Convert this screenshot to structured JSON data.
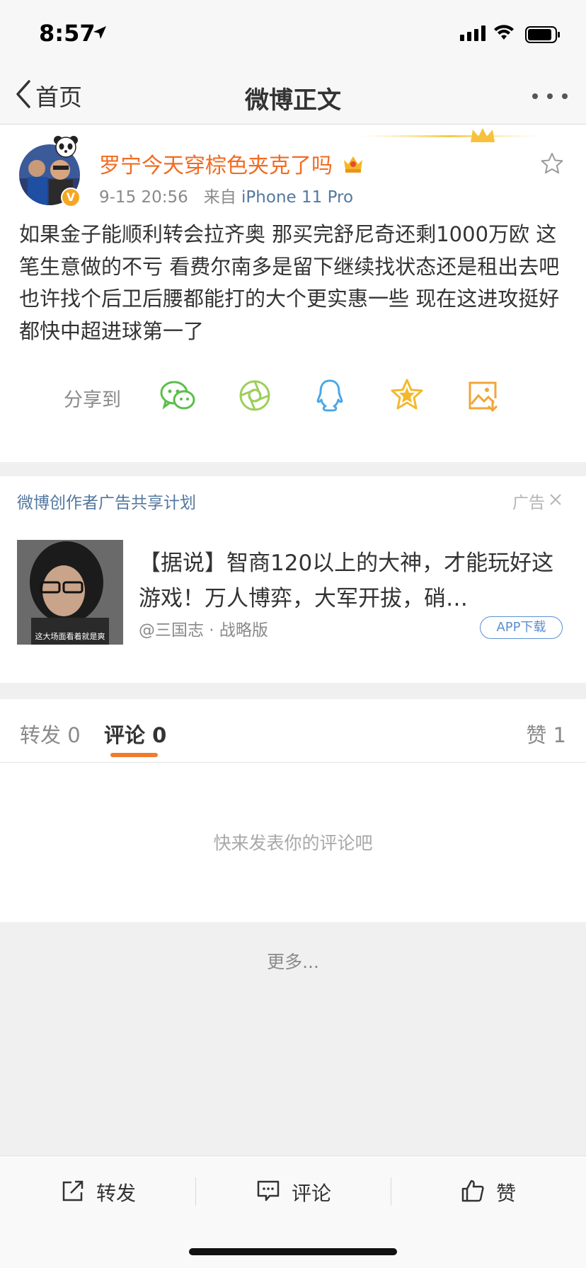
{
  "status_bar": {
    "time": "8:57"
  },
  "nav": {
    "back_label": "首页",
    "title": "微博正文"
  },
  "post": {
    "username": "罗宁今天穿棕色夹克了吗",
    "timestamp": "9-15 20:56",
    "source_prefix": "来自",
    "source_device": "iPhone 11 Pro",
    "text": "如果金子能顺利转会拉齐奥 那买完舒尼奇还剩1000万欧 这笔生意做的不亏 看费尔南多是留下继续找状态还是租出去吧 也许找个后卫后腰都能打的大个更实惠一些 现在这进攻挺好 都快中超进球第一了",
    "share_label": "分享到"
  },
  "ad": {
    "header": "微博创作者广告共享计划",
    "tag": "广告",
    "thumb_caption": "这大场面看着就是爽",
    "title": "【据说】智商120以上的大神，才能玩好这游戏！万人博弈，大军开拔，硝…",
    "source": "@三国志 · 战略版",
    "button": "APP下载"
  },
  "tabs": {
    "repost": "转发 0",
    "comment": "评论 0",
    "like": "赞 1"
  },
  "comments": {
    "empty_text": "快来发表你的评论吧"
  },
  "more": {
    "label": "更多..."
  },
  "bottom_bar": {
    "repost": "转发",
    "comment": "评论",
    "like": "赞"
  },
  "colors": {
    "accent": "#f07a2e",
    "username": "#f26b21",
    "link": "#53789f"
  }
}
